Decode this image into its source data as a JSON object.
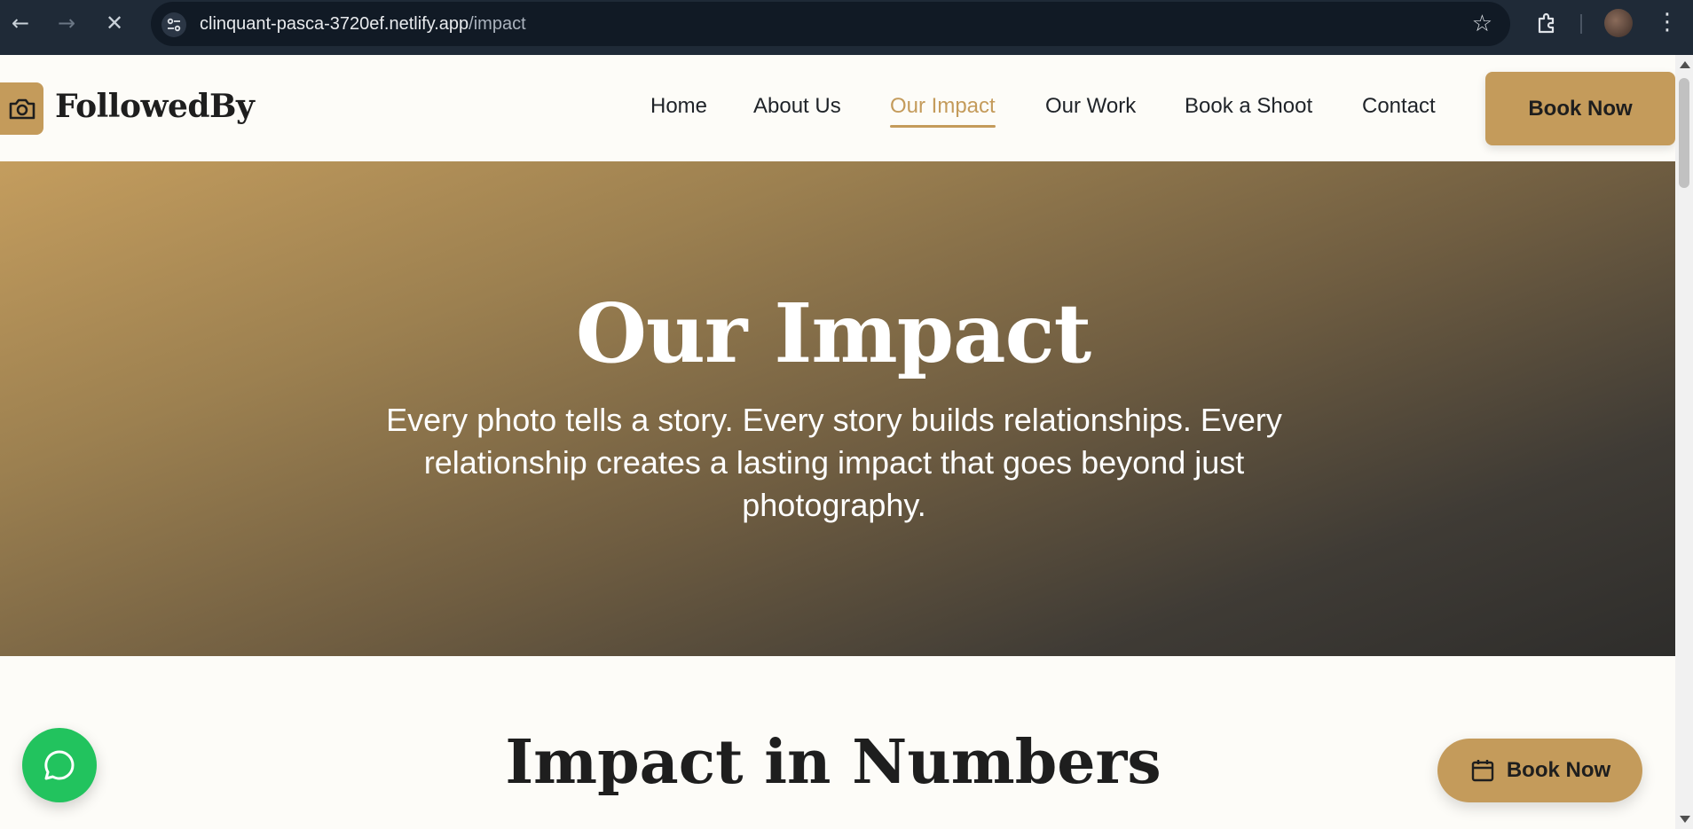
{
  "browser": {
    "url_host": "clinquant-pasca-3720ef.netlify.app",
    "url_path": "/impact",
    "icons": [
      "back-arrow-icon",
      "forward-arrow-icon",
      "close-icon",
      "site-info-icon",
      "star-icon",
      "extensions-icon",
      "profile-avatar",
      "more-menu-icon"
    ]
  },
  "header": {
    "brand": "FollowedBy",
    "brand_icon": "camera-icon",
    "nav": [
      {
        "label": "Home"
      },
      {
        "label": "About Us"
      },
      {
        "label": "Our Impact",
        "active": true
      },
      {
        "label": "Our Work"
      },
      {
        "label": "Book a Shoot"
      },
      {
        "label": "Contact"
      }
    ],
    "cta": "Book Now"
  },
  "hero": {
    "title": "Our Impact",
    "subtitle": "Every photo tells a story. Every story builds relationships. Every relationship creates a lasting impact that goes beyond just photography."
  },
  "section": {
    "title": "Impact in Numbers"
  },
  "floating": {
    "chat_icon": "whatsapp-chat-icon",
    "book_label": "Book Now",
    "book_icon": "calendar-icon"
  },
  "colors": {
    "accent": "#c49b5b",
    "whatsapp": "#22c35e",
    "chrome_bg": "#1f2a37",
    "page_bg": "#fdfcf8"
  }
}
